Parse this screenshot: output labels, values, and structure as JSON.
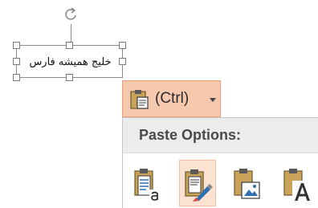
{
  "textbox": {
    "text": "خلیج همیشه فارس"
  },
  "paste_ctrl": {
    "label": "(Ctrl)",
    "icon": "clipboard-icon",
    "arrow_icon": "dropdown-arrow-icon"
  },
  "paste_options": {
    "title": "Paste Options:",
    "options": [
      {
        "icon": "use-destination-theme-icon",
        "selected": false
      },
      {
        "icon": "keep-source-formatting-icon",
        "selected": true
      },
      {
        "icon": "picture-icon",
        "selected": false
      },
      {
        "icon": "keep-text-only-icon",
        "selected": false
      }
    ]
  },
  "colors": {
    "ctrl_background": "#f6c8ae",
    "selected_option": "#fbe2d3",
    "header_background": "#ececec",
    "clipboard_board": "#c9a35a"
  }
}
